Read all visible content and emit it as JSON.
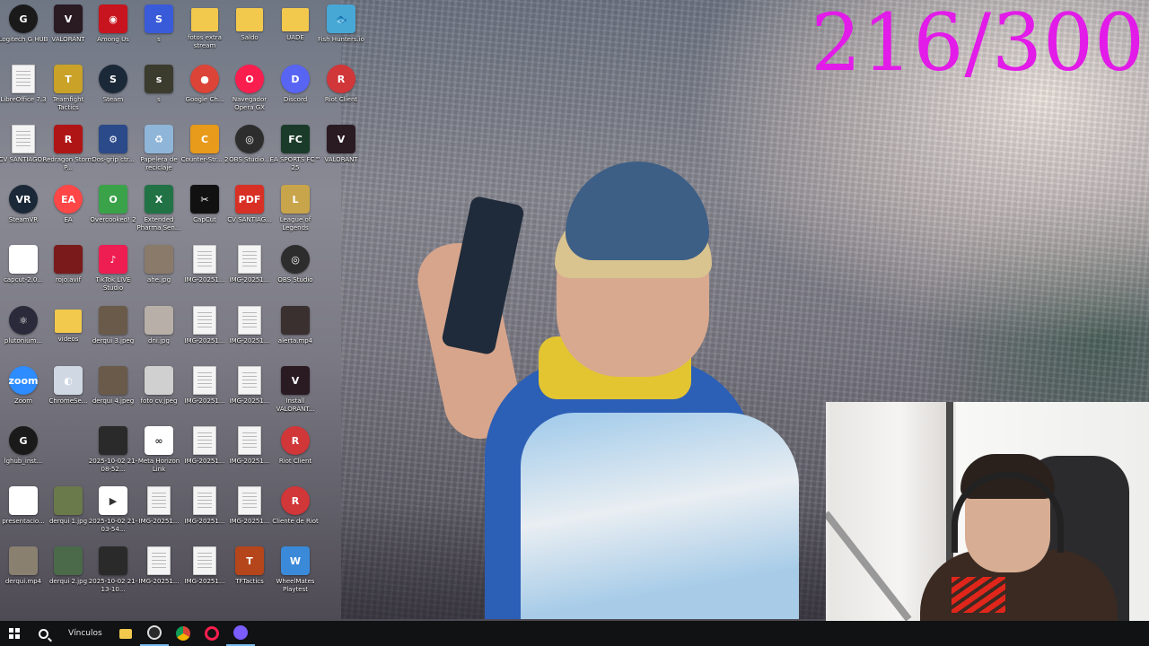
{
  "overlay": {
    "counter": "216/300"
  },
  "desktop": {
    "icons": [
      {
        "label": "Logitech G HUB",
        "glyph": "G",
        "color": "#1a1a1a",
        "kind": "round"
      },
      {
        "label": "VALORANT",
        "glyph": "V",
        "color": "#2a1a22",
        "kind": "tile"
      },
      {
        "label": "Among Us",
        "glyph": "◉",
        "color": "#c8141e",
        "kind": "tile"
      },
      {
        "label": "s",
        "glyph": "S",
        "color": "#3a5bd9",
        "kind": "tile"
      },
      {
        "label": "fotos extra stream",
        "glyph": "",
        "color": "#f2c94c",
        "kind": "folder"
      },
      {
        "label": "Saldo",
        "glyph": "",
        "color": "#f2c94c",
        "kind": "folder"
      },
      {
        "label": "UADE",
        "glyph": "",
        "color": "#f2c94c",
        "kind": "folder"
      },
      {
        "label": "Fish Hunters.io",
        "glyph": "🐟",
        "color": "#47a8d6",
        "kind": "tile"
      },
      {
        "label": "LibreOffice 7.3",
        "glyph": "",
        "color": "#ffffff",
        "kind": "doc"
      },
      {
        "label": "Teamfight Tactics",
        "glyph": "T",
        "color": "#c9a227",
        "kind": "tile"
      },
      {
        "label": "Steam",
        "glyph": "S",
        "color": "#1b2838",
        "kind": "round"
      },
      {
        "label": "s",
        "glyph": "s",
        "color": "#3b3b2e",
        "kind": "tile"
      },
      {
        "label": "Google Ch...",
        "glyph": "●",
        "color": "#db4437",
        "kind": "round"
      },
      {
        "label": "Navegador Opera GX",
        "glyph": "O",
        "color": "#fa1e4e",
        "kind": "round"
      },
      {
        "label": "Discord",
        "glyph": "D",
        "color": "#5865f2",
        "kind": "round"
      },
      {
        "label": "Riot Client",
        "glyph": "R",
        "color": "#d13639",
        "kind": "round"
      },
      {
        "label": "CV SANTIAGO...",
        "glyph": "",
        "color": "#ffffff",
        "kind": "doc"
      },
      {
        "label": "Redragon Storm P...",
        "glyph": "R",
        "color": "#b01515",
        "kind": "tile"
      },
      {
        "label": "Dos-grip ctr...",
        "glyph": "⚙",
        "color": "#2a4a8a",
        "kind": "tile"
      },
      {
        "label": "Papelera de reciclaje",
        "glyph": "♻",
        "color": "#8fb6d9",
        "kind": "tile"
      },
      {
        "label": "Counter-Str... 2",
        "glyph": "C",
        "color": "#e89a1a",
        "kind": "tile"
      },
      {
        "label": "OBS Studio...",
        "glyph": "◎",
        "color": "#2d2d2d",
        "kind": "round"
      },
      {
        "label": "EA SPORTS FC™ 25",
        "glyph": "FC",
        "color": "#1b3b2a",
        "kind": "tile"
      },
      {
        "label": "VALORANT",
        "glyph": "V",
        "color": "#2a1a22",
        "kind": "tile"
      },
      {
        "label": "SteamVR",
        "glyph": "VR",
        "color": "#1b2838",
        "kind": "round"
      },
      {
        "label": "EA",
        "glyph": "EA",
        "color": "#ff4747",
        "kind": "round"
      },
      {
        "label": "Overcooked! 2",
        "glyph": "O",
        "color": "#3aa34a",
        "kind": "tile"
      },
      {
        "label": "Extended Pharma Sen...",
        "glyph": "X",
        "color": "#217346",
        "kind": "tile"
      },
      {
        "label": "CapCut",
        "glyph": "✂",
        "color": "#111111",
        "kind": "tile"
      },
      {
        "label": "CV SANTIAG...",
        "glyph": "PDF",
        "color": "#d93025",
        "kind": "tile"
      },
      {
        "label": "League of Legends",
        "glyph": "L",
        "color": "#c8a44a",
        "kind": "tile"
      },
      {
        "label": "capcut-2.0...",
        "glyph": "",
        "color": "#ffffff",
        "kind": "tile"
      },
      {
        "label": "rojo.avif",
        "glyph": "",
        "color": "#7a1a1a",
        "kind": "tile"
      },
      {
        "label": "TikTok LIVE Studio",
        "glyph": "♪",
        "color": "#ee1d52",
        "kind": "tile"
      },
      {
        "label": "ahe.jpg",
        "glyph": "",
        "color": "#8a7a6a",
        "kind": "tile"
      },
      {
        "label": "IMG-20251...",
        "glyph": "",
        "color": "#ffffff",
        "kind": "doc"
      },
      {
        "label": "IMG-20251...",
        "glyph": "",
        "color": "#ffffff",
        "kind": "doc"
      },
      {
        "label": "OBS Studio",
        "glyph": "◎",
        "color": "#2d2d2d",
        "kind": "round"
      },
      {
        "label": "plutonium...",
        "glyph": "⚛",
        "color": "#2a2a3a",
        "kind": "round"
      },
      {
        "label": "videos",
        "glyph": "",
        "color": "#f2c94c",
        "kind": "folder"
      },
      {
        "label": "derqui 3.jpeg",
        "glyph": "",
        "color": "#6a5a4a",
        "kind": "tile"
      },
      {
        "label": "dni.jpg",
        "glyph": "",
        "color": "#b8b0a8",
        "kind": "tile"
      },
      {
        "label": "IMG-20251...",
        "glyph": "",
        "color": "#ffffff",
        "kind": "doc"
      },
      {
        "label": "IMG-20251...",
        "glyph": "",
        "color": "#ffffff",
        "kind": "doc"
      },
      {
        "label": "alerta.mp4",
        "glyph": "",
        "color": "#3a3030",
        "kind": "tile"
      },
      {
        "label": "Zoom",
        "glyph": "zoom",
        "color": "#2d8cff",
        "kind": "round"
      },
      {
        "label": "ChromeSe...",
        "glyph": "◐",
        "color": "#cfd8e3",
        "kind": "tile"
      },
      {
        "label": "derqui 4.jpeg",
        "glyph": "",
        "color": "#6a5a4a",
        "kind": "tile"
      },
      {
        "label": "foto cv.jpeg",
        "glyph": "",
        "color": "#d0d0d0",
        "kind": "tile"
      },
      {
        "label": "IMG-20251...",
        "glyph": "",
        "color": "#ffffff",
        "kind": "doc"
      },
      {
        "label": "IMG-20251...",
        "glyph": "",
        "color": "#ffffff",
        "kind": "doc"
      },
      {
        "label": "Install VALORANT...",
        "glyph": "V",
        "color": "#2a1a22",
        "kind": "tile"
      },
      {
        "label": "lghub_inst...",
        "glyph": "G",
        "color": "#1a1a1a",
        "kind": "round"
      },
      {
        "label": "2025-10-02 21-08-52...",
        "glyph": "",
        "color": "#2a2a2a",
        "kind": "tile"
      },
      {
        "label": "Meta Horizon Link",
        "glyph": "∞",
        "color": "#ffffff",
        "kind": "tile"
      },
      {
        "label": "IMG-20251...",
        "glyph": "",
        "color": "#ffffff",
        "kind": "doc"
      },
      {
        "label": "IMG-20251...",
        "glyph": "",
        "color": "#ffffff",
        "kind": "doc"
      },
      {
        "label": "Riot Client",
        "glyph": "R",
        "color": "#d13639",
        "kind": "round"
      },
      {
        "label": "presentacio...",
        "glyph": "",
        "color": "#ffffff",
        "kind": "tile"
      },
      {
        "label": "derqui 1.jpg",
        "glyph": "",
        "color": "#6a7a4a",
        "kind": "tile"
      },
      {
        "label": "2025-10-02 21-03-54...",
        "glyph": "▶",
        "color": "#ffffff",
        "kind": "tile"
      },
      {
        "label": "IMG-20251...",
        "glyph": "",
        "color": "#ffffff",
        "kind": "doc"
      },
      {
        "label": "IMG-20251...",
        "glyph": "",
        "color": "#ffffff",
        "kind": "doc"
      },
      {
        "label": "IMG-20251...",
        "glyph": "",
        "color": "#ffffff",
        "kind": "doc"
      },
      {
        "label": "Cliente de Riot",
        "glyph": "R",
        "color": "#d13639",
        "kind": "round"
      },
      {
        "label": "derqui.mp4",
        "glyph": "",
        "color": "#8a8070",
        "kind": "tile"
      },
      {
        "label": "derqui 2.jpg",
        "glyph": "",
        "color": "#4a6a4a",
        "kind": "tile"
      },
      {
        "label": "2025-10-02 21-13-10...",
        "glyph": "",
        "color": "#2a2a2a",
        "kind": "tile"
      },
      {
        "label": "IMG-20251...",
        "glyph": "",
        "color": "#ffffff",
        "kind": "doc"
      },
      {
        "label": "IMG-20251...",
        "glyph": "",
        "color": "#ffffff",
        "kind": "doc"
      },
      {
        "label": "TFTactics",
        "glyph": "T",
        "color": "#b5451b",
        "kind": "tile"
      },
      {
        "label": "WheelMates Playtest",
        "glyph": "W",
        "color": "#3a8ad9",
        "kind": "tile"
      }
    ]
  },
  "taskbar": {
    "links_label": "Vínculos",
    "apps": [
      {
        "name": "file-explorer",
        "color": "#f2c94c"
      },
      {
        "name": "logitech-g-hub",
        "color": "#2a2a2a"
      },
      {
        "name": "google-chrome",
        "color": "#db4437"
      },
      {
        "name": "opera-gx",
        "color": "#fa1e4e"
      },
      {
        "name": "app-purple",
        "color": "#7b5cff"
      }
    ]
  }
}
